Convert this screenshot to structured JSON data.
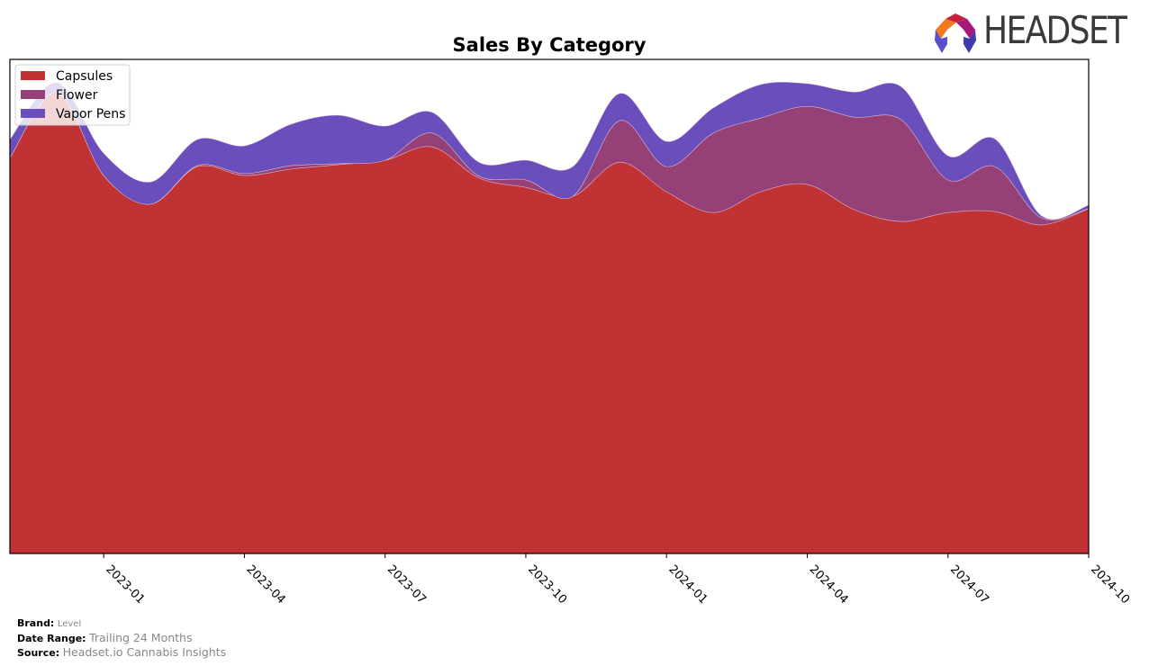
{
  "logo": {
    "text": "HEADSET",
    "name": "headset-logo"
  },
  "footer": {
    "brand_label": "Brand:",
    "brand_value": "Level",
    "date_range_label": "Date Range:",
    "date_range_value": "Trailing 24 Months",
    "source_label": "Source:",
    "source_value": "Headset.io Cannabis Insights"
  },
  "chart_data": {
    "type": "area",
    "stacked": true,
    "smoothed": true,
    "title": "Sales By Category",
    "xlabel": "",
    "ylabel": "",
    "x": [
      "2022-11",
      "2022-12",
      "2023-01",
      "2023-02",
      "2023-03",
      "2023-04",
      "2023-05",
      "2023-06",
      "2023-07",
      "2023-08",
      "2023-09",
      "2023-10",
      "2023-11",
      "2023-12",
      "2024-01",
      "2024-02",
      "2024-03",
      "2024-04",
      "2024-05",
      "2024-06",
      "2024-07",
      "2024-08",
      "2024-09",
      "2024-10"
    ],
    "xticks": [
      "2023-01",
      "2023-04",
      "2023-07",
      "2023-10",
      "2024-01",
      "2024-04",
      "2024-07",
      "2024-10"
    ],
    "ylim": [
      0,
      100
    ],
    "yticks_visible": false,
    "grid": false,
    "legend_position": "top-left",
    "series": [
      {
        "name": "Capsules",
        "color": "#c03233",
        "values": [
          80.1,
          93.3,
          76.5,
          70.7,
          78.3,
          76.5,
          77.8,
          78.7,
          79.6,
          82.3,
          76.0,
          74.1,
          72.3,
          79.2,
          73.2,
          69.0,
          73.2,
          74.7,
          69.6,
          67.2,
          69.0,
          69.2,
          66.5,
          69.8
        ]
      },
      {
        "name": "Flower",
        "color": "#954177",
        "values": [
          0.0,
          0.0,
          0.0,
          0.0,
          0.2,
          0.4,
          0.7,
          0.2,
          0.0,
          2.8,
          0.4,
          1.5,
          0.0,
          8.4,
          5.1,
          16.1,
          14.9,
          15.8,
          18.7,
          20.6,
          6.6,
          9.1,
          1.4,
          0.0
        ]
      },
      {
        "name": "Vapor Pens",
        "color": "#6a4fbc",
        "values": [
          3.7,
          2.0,
          4.5,
          4.5,
          5.3,
          5.6,
          8.4,
          9.8,
          6.9,
          4.2,
          2.8,
          4.0,
          6.0,
          5.5,
          5.1,
          5.1,
          6.8,
          4.6,
          5.1,
          6.7,
          4.9,
          5.6,
          0.4,
          0.7
        ]
      }
    ]
  }
}
